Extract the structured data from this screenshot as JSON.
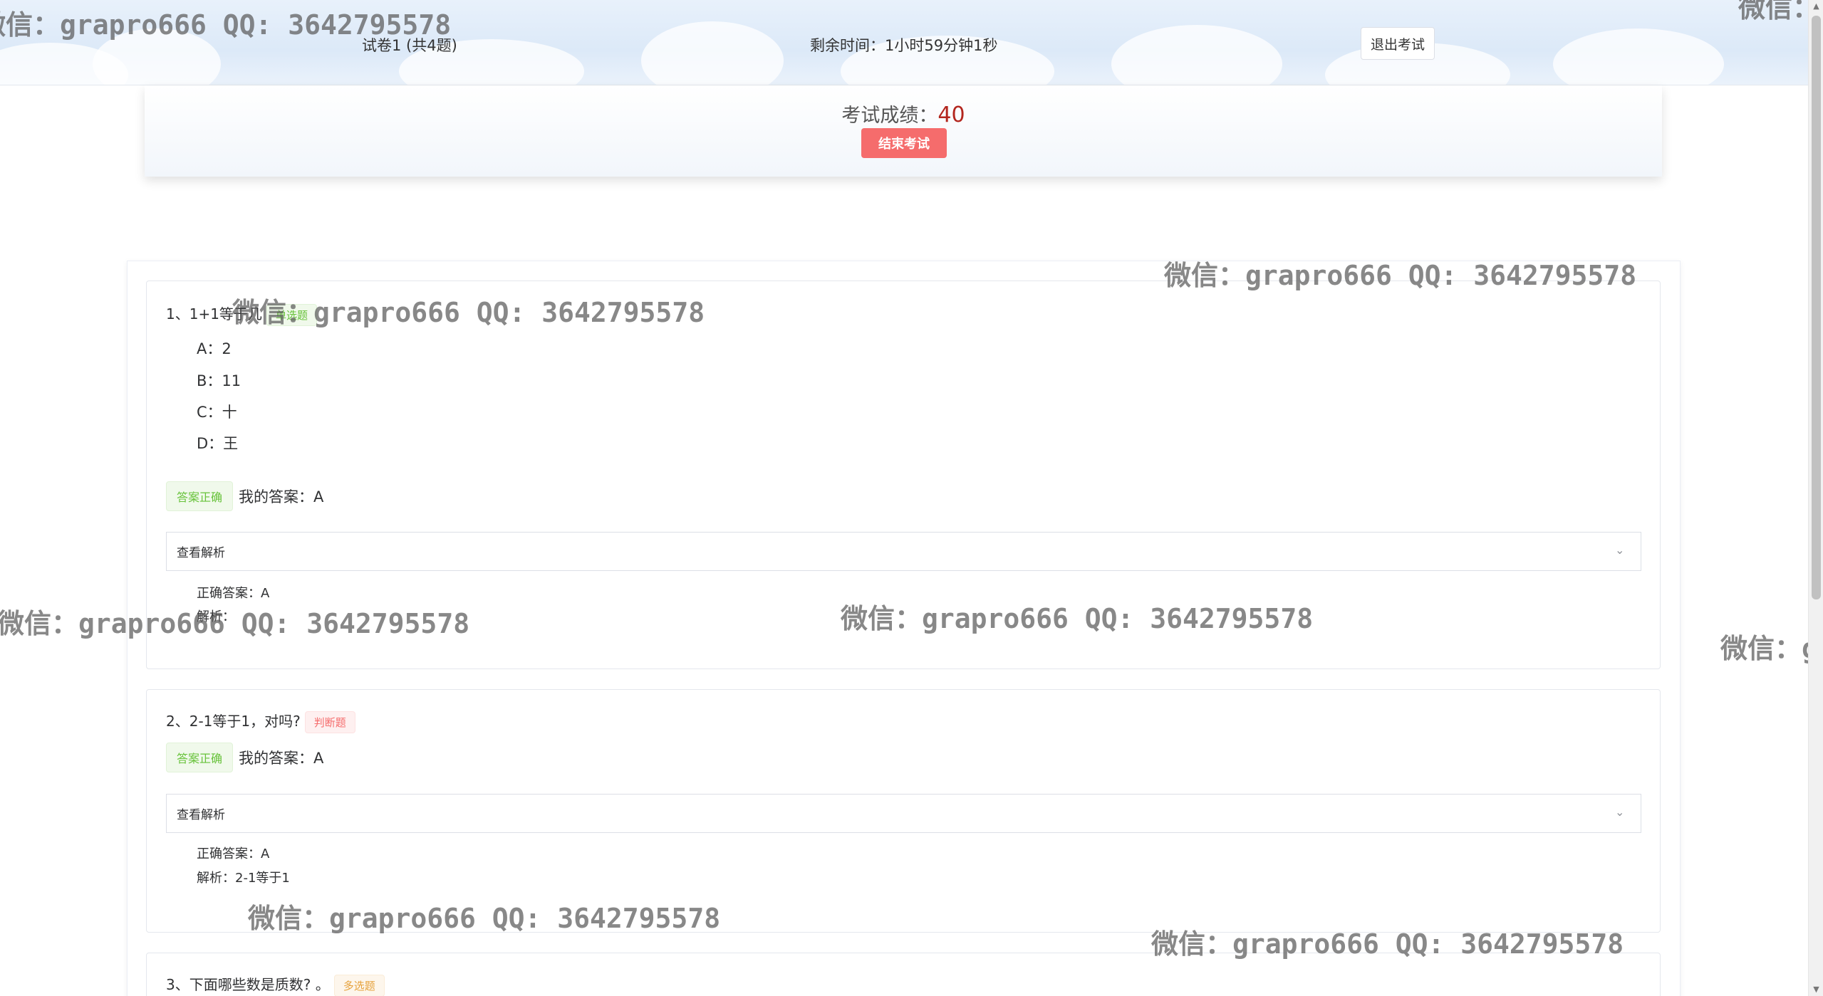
{
  "header": {
    "paper_title": "试卷1 (共4题)",
    "remaining_time": "剩余时间：1小时59分钟1秒",
    "exit_button": "退出考试"
  },
  "score": {
    "label": "考试成绩：",
    "value": "40",
    "end_button": "结束考试"
  },
  "questions": [
    {
      "title": "1、1+1等于几",
      "type_tag": "单选题",
      "options": [
        "A：2",
        "B：11",
        "C：十",
        "D：王"
      ],
      "result_tag": "答案正确",
      "my_answer": "我的答案：A",
      "analysis_toggle": "查看解析",
      "correct_answer": "正确答案：A",
      "analysis": "解析："
    },
    {
      "title": "2、2-1等于1，对吗?",
      "type_tag": "判断题",
      "result_tag": "答案正确",
      "my_answer": "我的答案：A",
      "analysis_toggle": "查看解析",
      "correct_answer": "正确答案：A",
      "analysis": "解析：2-1等于1"
    },
    {
      "title": "3、下面哪些数是质数? 。",
      "type_tag": "多选题"
    }
  ],
  "watermark": "微信：grapro666 QQ: 3642795578",
  "colors": {
    "accent_red": "#f56c6c",
    "score_red": "#b3261e",
    "success_green": "#67c23a",
    "warning_orange": "#e6a23c"
  }
}
